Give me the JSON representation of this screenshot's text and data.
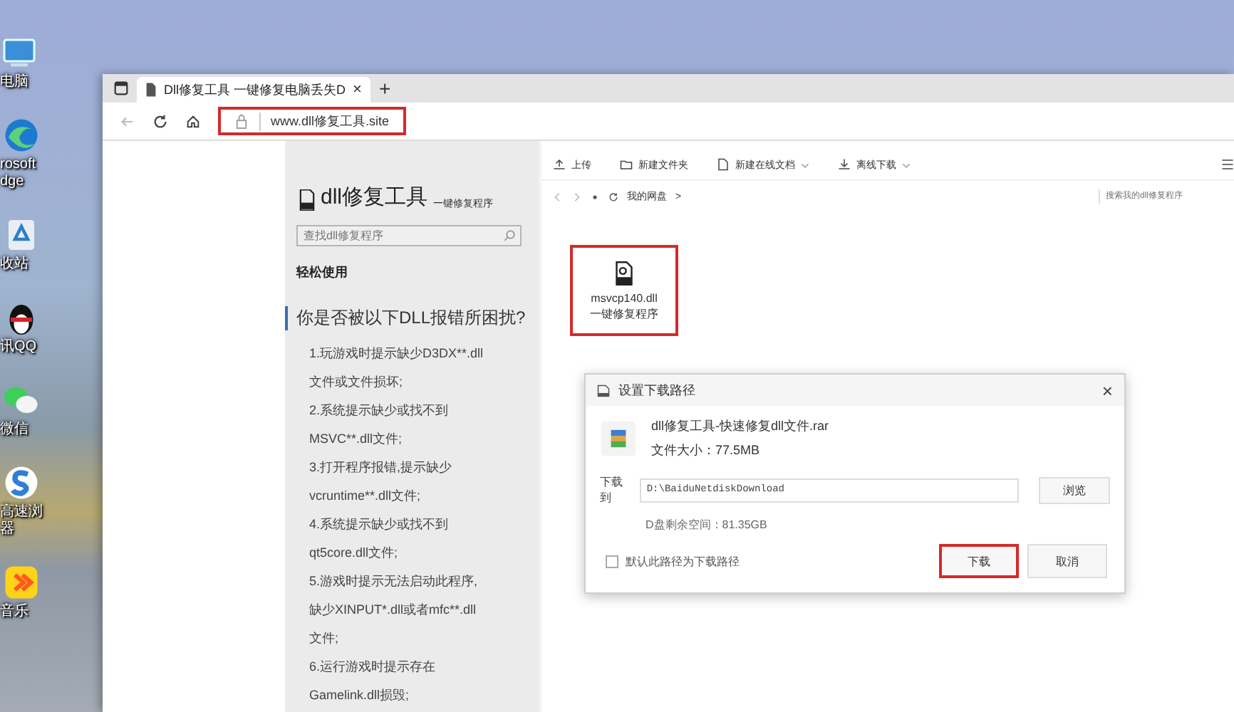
{
  "desktop_icons": [
    {
      "kind": "monitor",
      "lines": [
        "电脑"
      ]
    },
    {
      "kind": "swirl",
      "lines": [
        "rosoft",
        "dge"
      ]
    },
    {
      "kind": "recycle",
      "lines": [
        "收站"
      ]
    },
    {
      "kind": "penguin",
      "lines": [
        "讯QQ"
      ]
    },
    {
      "kind": "chat",
      "lines": [
        "微信"
      ]
    },
    {
      "kind": "s",
      "lines": [
        "高速浏",
        "器"
      ]
    },
    {
      "kind": "music",
      "lines": [
        "音乐"
      ]
    }
  ],
  "browser": {
    "tab": {
      "title": "Dll修复工具 一键修复电脑丢失D",
      "close": "×"
    },
    "new_tab": "+",
    "address": {
      "value": "www.dll修复工具.site",
      "highlighted": true
    }
  },
  "sidebar": {
    "title": "dll修复工具",
    "subtitle": "一键修复程序",
    "search": {
      "placeholder": "查找dll修复程序"
    },
    "section": "轻松使用",
    "heading": "你是否被以下DLL报错所困扰?",
    "lines": [
      "1.玩游戏时提示缺少D3DX**.dll",
      "文件或文件损坏;",
      "2.系统提示缺少或找不到",
      "MSVC**.dll文件;",
      "3.打开程序报错,提示缺少",
      "vcruntime**.dll文件;",
      "4.系统提示缺少或找不到",
      "qt5core.dll文件;",
      "5.游戏时提示无法启动此程序,",
      "缺少XINPUT*.dll或者mfc**.dll",
      "文件;",
      "6.运行游戏时提示存在",
      "Gamelink.dll损毁;"
    ]
  },
  "toolbar": [
    {
      "kind": "upload",
      "label": "上传",
      "caret": false
    },
    {
      "kind": "folder",
      "label": "新建文件夹",
      "caret": false
    },
    {
      "kind": "doc",
      "label": "新建在线文档",
      "caret": true
    },
    {
      "kind": "download",
      "label": "离线下载",
      "caret": true
    }
  ],
  "breadcrumb": {
    "item": "我的网盘",
    "separator": ">"
  },
  "search": {
    "placeholder": "搜索我的dll修复程序"
  },
  "file": {
    "name": "msvcp140.dll",
    "caption": "一键修复程序",
    "highlighted": true
  },
  "dialog": {
    "title": "设置下载路径",
    "close": "×",
    "file_name": "dll修复工具-快速修复dll文件.rar",
    "file_size": "文件大小：77.5MB",
    "path_label": "下载到",
    "path": "D:\\BaiduNetdiskDownload",
    "browse": "浏览",
    "free_space": "D盘剩余空间：81.35GB",
    "default_checkbox": {
      "label": "默认此路径为下载路径",
      "checked": false
    },
    "buttons": [
      {
        "label": "下载",
        "highlighted": true
      },
      {
        "label": "取消",
        "highlighted": false
      }
    ]
  }
}
